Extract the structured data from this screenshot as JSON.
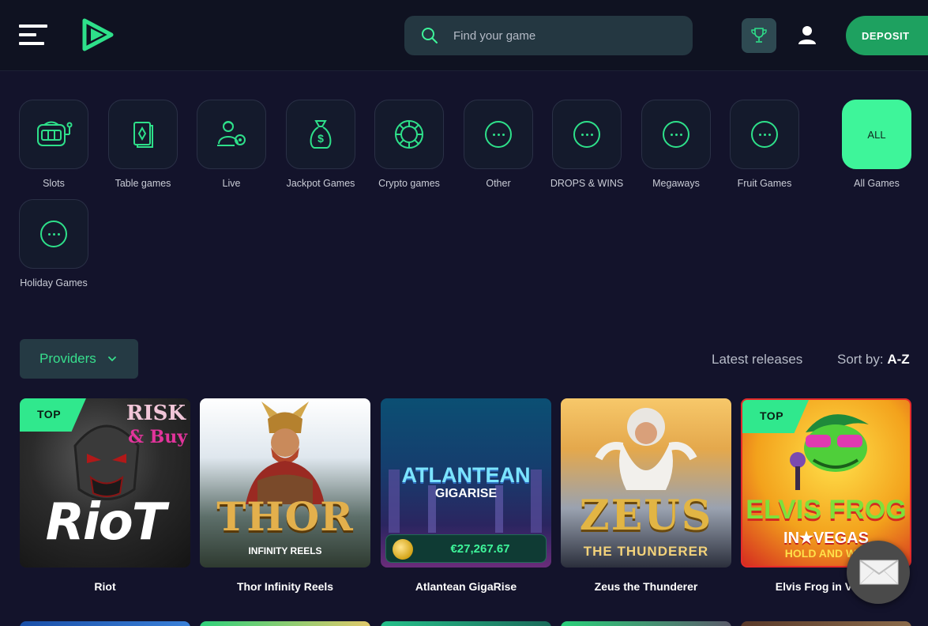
{
  "header": {
    "search_placeholder": "Find your game",
    "deposit_label": "DEPOSIT"
  },
  "categories": [
    {
      "label": "Slots",
      "icon": "slot-machine-icon"
    },
    {
      "label": "Table games",
      "icon": "cards-icon"
    },
    {
      "label": "Live",
      "icon": "live-dealer-icon"
    },
    {
      "label": "Jackpot Games",
      "icon": "money-bag-icon"
    },
    {
      "label": "Crypto games",
      "icon": "crypto-icon"
    },
    {
      "label": "Other",
      "icon": "more-icon"
    },
    {
      "label": "DROPS & WINS",
      "icon": "more-icon"
    },
    {
      "label": "Megaways",
      "icon": "more-icon"
    },
    {
      "label": "Fruit Games",
      "icon": "more-icon"
    },
    {
      "label": "All Games",
      "tile_text": "ALL",
      "active": true
    },
    {
      "label": "Holiday Games",
      "icon": "more-icon"
    }
  ],
  "filters": {
    "providers_label": "Providers",
    "latest_label": "Latest releases",
    "sort_prefix": "Sort by:",
    "sort_value": "A-Z"
  },
  "games": [
    {
      "title": "Riot",
      "badge": "TOP",
      "art": {
        "main": "RioT",
        "sub1": "RISK",
        "sub2": "& Buy"
      }
    },
    {
      "title": "Thor Infinity Reels",
      "art": {
        "main": "THOR",
        "sub1": "INFINITY REELS"
      }
    },
    {
      "title": "Atlantean GigaRise",
      "art": {
        "main": "ATLANTEAN",
        "sub1": "GIGARISE"
      },
      "jackpot": "€27,267.67"
    },
    {
      "title": "Zeus the Thunderer",
      "art": {
        "main": "ZEUS",
        "sub1": "THE THUNDERER"
      }
    },
    {
      "title": "Elvis Frog in Vegas",
      "badge": "TOP",
      "art": {
        "main": "ELVIS FROG",
        "sub1": "IN★VEGAS",
        "sub2": "HOLD AND WIN"
      }
    }
  ],
  "colors": {
    "accent": "#3ef59a",
    "deposit": "#1ea160",
    "background": "#13132b",
    "header": "#0f1221"
  }
}
